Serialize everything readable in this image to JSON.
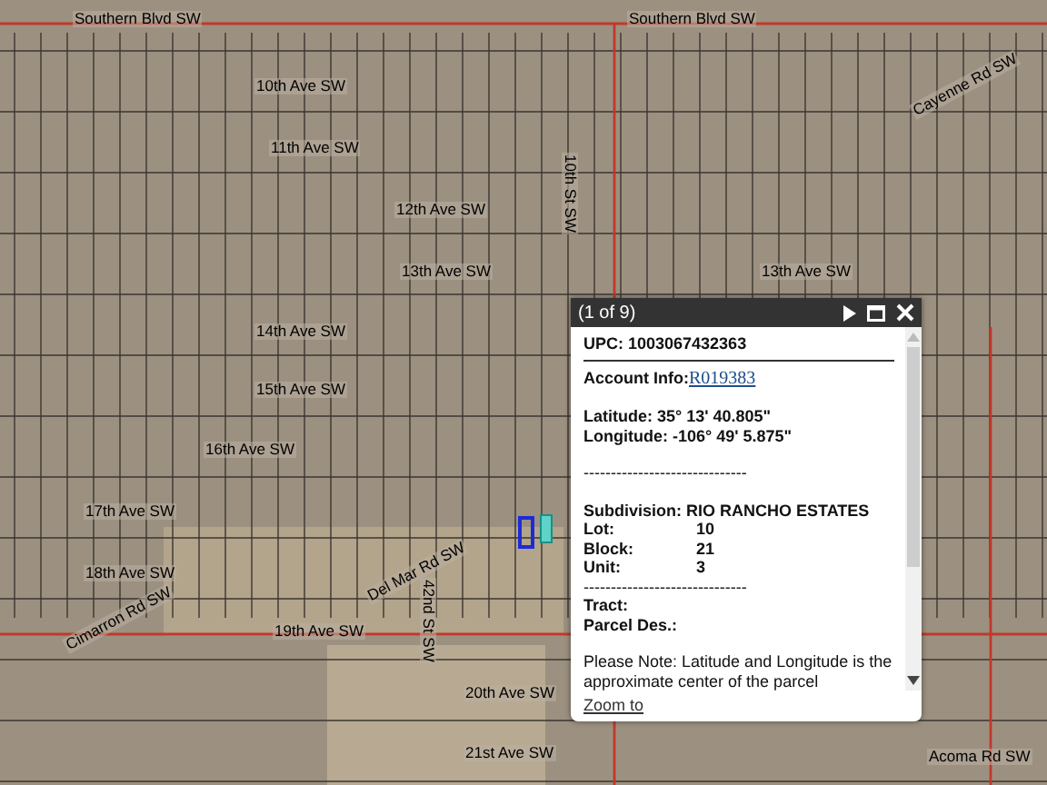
{
  "map": {
    "labels": [
      {
        "text": "Southern Blvd SW",
        "kind": "h"
      },
      {
        "text": "Southern Blvd SW",
        "kind": "h"
      },
      {
        "text": "10th Ave SW",
        "kind": "h"
      },
      {
        "text": "11th Ave SW",
        "kind": "h"
      },
      {
        "text": "12th Ave SW",
        "kind": "h"
      },
      {
        "text": "13th Ave SW",
        "kind": "h"
      },
      {
        "text": "13th Ave SW",
        "kind": "h"
      },
      {
        "text": "14th Ave SW",
        "kind": "h"
      },
      {
        "text": "15th Ave SW",
        "kind": "h"
      },
      {
        "text": "16th Ave SW",
        "kind": "h"
      },
      {
        "text": "17th Ave SW",
        "kind": "h"
      },
      {
        "text": "18th Ave SW",
        "kind": "h"
      },
      {
        "text": "19th Ave SW",
        "kind": "h"
      },
      {
        "text": "20th Ave SW",
        "kind": "h"
      },
      {
        "text": "21st Ave SW",
        "kind": "h"
      },
      {
        "text": "10th St SW",
        "kind": "v"
      },
      {
        "text": "42nd St SW",
        "kind": "v"
      },
      {
        "text": "Del Mar Rd SW",
        "kind": "d"
      },
      {
        "text": "Cimarron Rd SW",
        "kind": "d"
      },
      {
        "text": "Cayenne Rd SW",
        "kind": "d"
      },
      {
        "text": "Acoma Rd SW",
        "kind": "h"
      }
    ]
  },
  "popup": {
    "title": "(1 of 9)",
    "lines": [
      {
        "kind": "bold",
        "text": "UPC: 1003067432363"
      },
      {
        "kind": "rule"
      },
      {
        "kind": "link",
        "label": "Account Info:",
        "link": "R019383"
      },
      {
        "kind": "gap"
      },
      {
        "kind": "bold",
        "text": "Latitude: 35° 13' 40.805\""
      },
      {
        "kind": "bold",
        "text": "Longitude: -106° 49' 5.875\""
      },
      {
        "kind": "gap"
      },
      {
        "kind": "plain",
        "text": "------------------------------"
      },
      {
        "kind": "gap"
      },
      {
        "kind": "bold",
        "text": "Subdivision: RIO RANCHO ESTATES"
      },
      {
        "kind": "pair",
        "label": "Lot:",
        "value": "10"
      },
      {
        "kind": "pair",
        "label": "Block:",
        "value": "21"
      },
      {
        "kind": "pair",
        "label": "Unit:",
        "value": "3"
      },
      {
        "kind": "plain",
        "text": "------------------------------"
      },
      {
        "kind": "bold",
        "text": "Tract:"
      },
      {
        "kind": "bold",
        "text": "Parcel Des.:"
      },
      {
        "kind": "gap"
      },
      {
        "kind": "plain",
        "text": "Please Note: Latitude and Longitude is the approximate center of the parcel"
      }
    ],
    "footer_link": "Zoom to"
  }
}
